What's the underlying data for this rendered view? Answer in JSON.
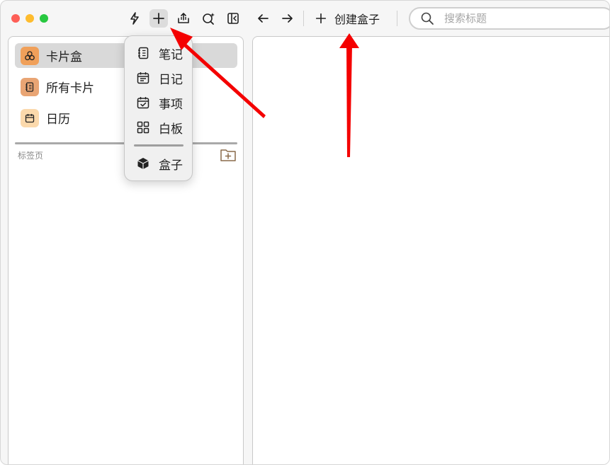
{
  "toolbar": {
    "create_box_label": "创建盒子",
    "search_placeholder": "搜索标题"
  },
  "sidebar": {
    "items": [
      {
        "label": "卡片盒",
        "icon": "cluster-icon"
      },
      {
        "label": "所有卡片",
        "icon": "notebook-icon"
      },
      {
        "label": "日历",
        "icon": "calendar-icon"
      }
    ],
    "section_label": "标签页"
  },
  "menu": {
    "items": [
      {
        "label": "笔记",
        "icon": "notebook-icon"
      },
      {
        "label": "日记",
        "icon": "calendar-lines-icon"
      },
      {
        "label": "事项",
        "icon": "calendar-check-icon"
      },
      {
        "label": "白板",
        "icon": "grid-icon"
      },
      {
        "label": "盒子",
        "icon": "box-icon"
      }
    ]
  },
  "colors": {
    "selected_bg": "#d9d9d9",
    "sidebar_icon_box": "#f0a05a",
    "sidebar_icon_cards": "#e9a574",
    "sidebar_icon_calendar": "#fbd9ac",
    "arrow": "#f40000"
  }
}
